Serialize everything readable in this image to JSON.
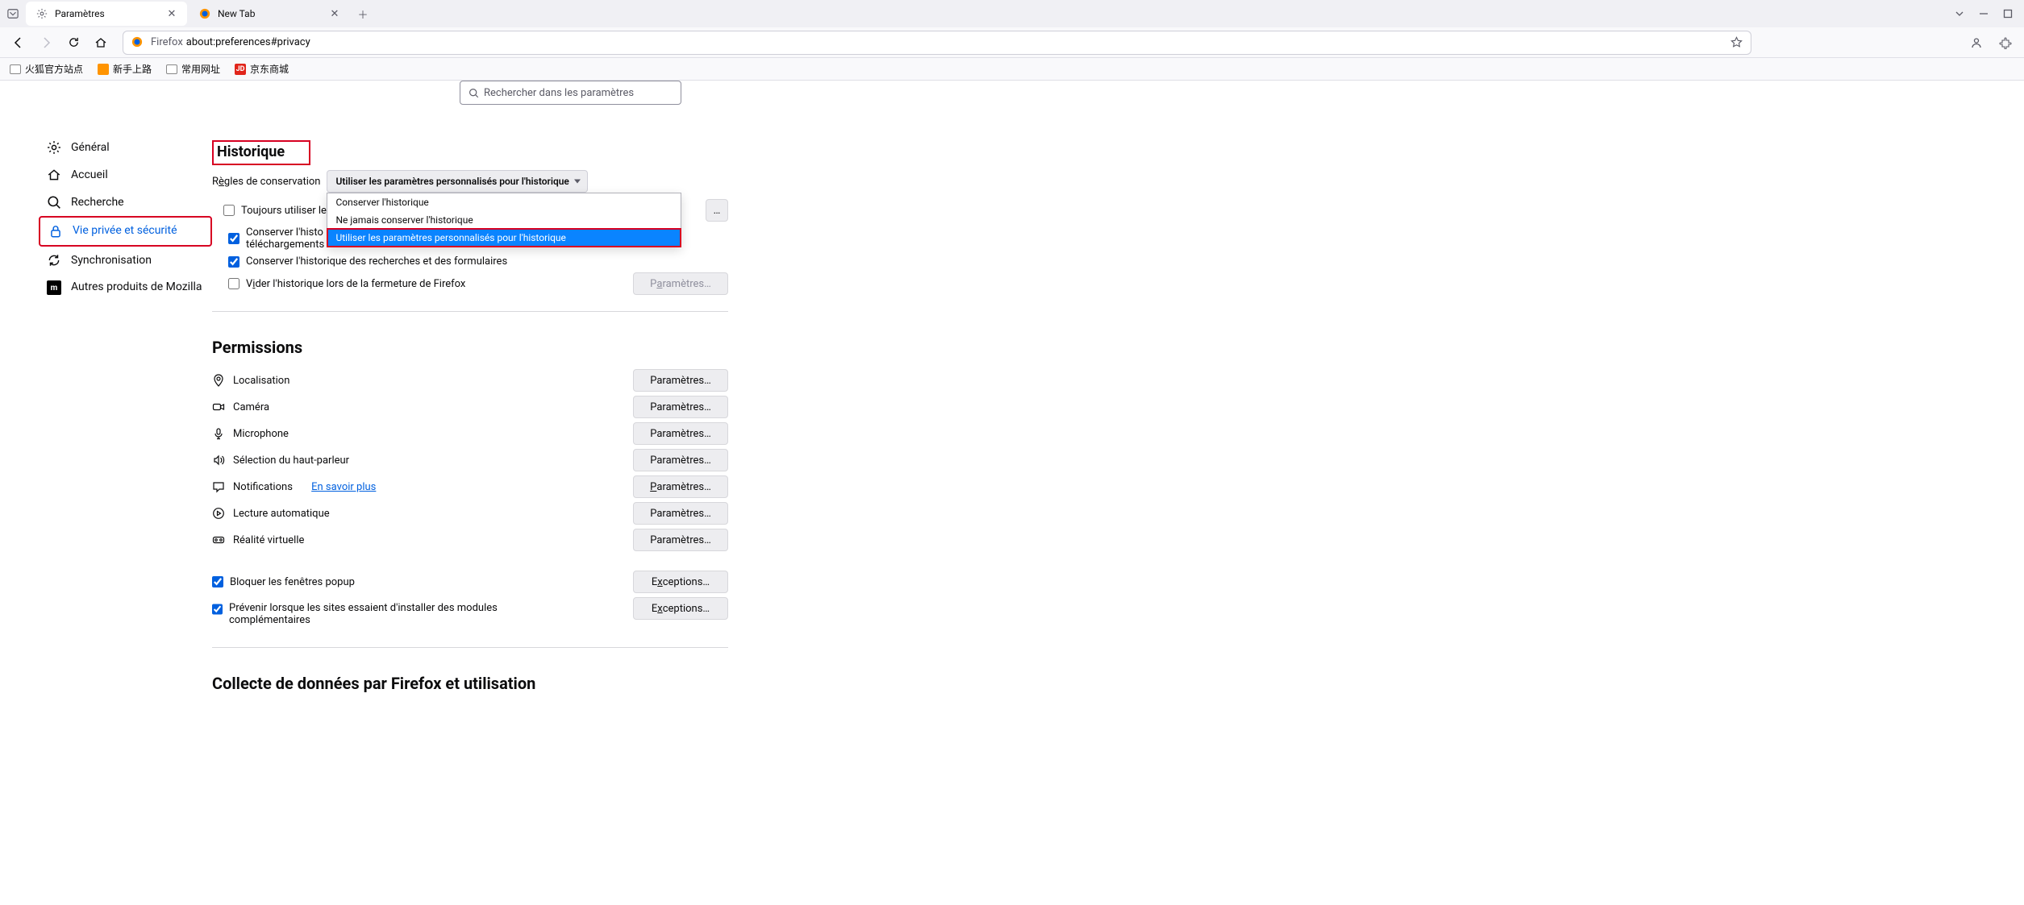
{
  "tabs": [
    {
      "label": "Paramètres"
    },
    {
      "label": "New Tab"
    }
  ],
  "urlbar": {
    "prefix": "Firefox",
    "path": "about:preferences#privacy"
  },
  "bookmarks": [
    {
      "label": "火狐官方站点",
      "kind": "folder"
    },
    {
      "label": "新手上路",
      "kind": "fx"
    },
    {
      "label": "常用网址",
      "kind": "folder"
    },
    {
      "label": "京东商城",
      "kind": "jd"
    }
  ],
  "search": {
    "placeholder": "Rechercher dans les paramètres"
  },
  "categories": {
    "general": "Général",
    "home": "Accueil",
    "search": "Recherche",
    "privacy": "Vie privée et sécurité",
    "sync": "Synchronisation",
    "more": "Autres produits de Mozilla"
  },
  "history": {
    "title": "Historique",
    "rules_label_pre": "R",
    "rules_label_u": "è",
    "rules_label_post": "gles de conservation",
    "select_value": "Utiliser les paramètres personnalisés pour l'historique",
    "options": [
      "Conserver l'historique",
      "Ne jamais conserver l'historique",
      "Utiliser les paramètres personnalisés pour l'historique"
    ],
    "always_private": "Toujours utiliser le m",
    "keep_history_dl": "Conserver l'histo",
    "keep_history_dl2": "téléchargements",
    "keep_forms": "Conserver l'historique des recherches et des formulaires",
    "clear_on_close_pre": "V",
    "clear_on_close_u": "i",
    "clear_on_close_post": "der l'historique lors de la fermeture de Firefox",
    "settings_btn_pre": "P",
    "settings_btn_u": "a",
    "settings_btn_post": "ramètres…"
  },
  "permissions": {
    "title": "Permissions",
    "location": "Localisation",
    "camera": "Caméra",
    "microphone": "Microphone",
    "speaker": "Sélection du haut-parleur",
    "notifications": "Notifications",
    "notifications_link": "En savoir plus",
    "autoplay": "Lecture automatique",
    "vr": "Réalité virtuelle",
    "settings_btn": "Paramètres…",
    "block_popups": "Bloquer les fenêtres popup",
    "warn_addons": "Prévenir lorsque les sites essaient d'installer des modules complémentaires",
    "exceptions_btn_pre": "E",
    "exceptions_btn_u": "x",
    "exceptions_btn_post": "ceptions…"
  },
  "datacollection": {
    "title": "Collecte de données par Firefox et utilisation"
  }
}
